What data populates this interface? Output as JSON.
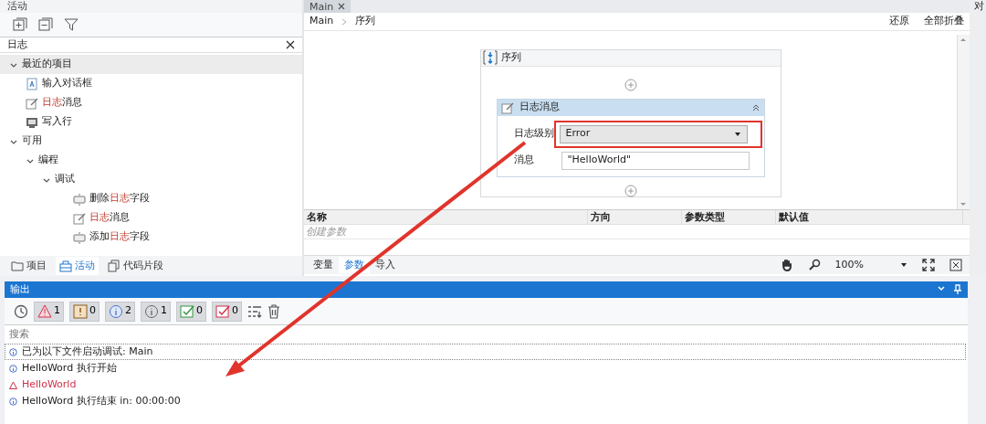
{
  "activities_panel": {
    "title": "活动",
    "search": {
      "value": "日志"
    },
    "tree": [
      {
        "label": "最近的项目",
        "expanded": true,
        "selected": true,
        "children": [
          {
            "kind": "dialog",
            "selected": false,
            "parts": [
              {
                "text": "输入对话框",
                "match": false
              }
            ]
          },
          {
            "kind": "log",
            "selected": false,
            "parts": [
              {
                "text": "日志",
                "match": true
              },
              {
                "text": "消息",
                "match": false
              }
            ]
          },
          {
            "kind": "writeline",
            "selected": false,
            "parts": [
              {
                "text": "写入行",
                "match": false
              }
            ]
          }
        ]
      },
      {
        "label": "可用",
        "expanded": true,
        "selected": false,
        "children": [
          {
            "label": "编程",
            "expanded": true,
            "selected": false,
            "children": [
              {
                "label": "调试",
                "expanded": true,
                "selected": false,
                "children": [
                  {
                    "kind": "field",
                    "selected": false,
                    "parts": [
                      {
                        "text": "删除",
                        "match": false
                      },
                      {
                        "text": "日志",
                        "match": true
                      },
                      {
                        "text": "字段",
                        "match": false
                      }
                    ]
                  },
                  {
                    "kind": "log",
                    "selected": false,
                    "parts": [
                      {
                        "text": "日志",
                        "match": true
                      },
                      {
                        "text": "消息",
                        "match": false
                      }
                    ]
                  },
                  {
                    "kind": "field",
                    "selected": false,
                    "parts": [
                      {
                        "text": "添加",
                        "match": false
                      },
                      {
                        "text": "日志",
                        "match": true
                      },
                      {
                        "text": "字段",
                        "match": false
                      }
                    ]
                  }
                ]
              }
            ]
          }
        ]
      }
    ],
    "bottom_tabs": [
      {
        "label": "项目",
        "kind": "folder",
        "selected": false
      },
      {
        "label": "活动",
        "kind": "activities",
        "selected": true
      },
      {
        "label": "代码片段",
        "kind": "snippets",
        "selected": false
      }
    ]
  },
  "editor": {
    "tabs": [
      {
        "label": "Main",
        "selected": true
      }
    ],
    "breadcrumb": [
      "Main",
      "序列"
    ],
    "actions": [
      "还原",
      "全部折叠"
    ],
    "sequence": {
      "title": "序列",
      "activity": {
        "title": "日志消息",
        "fields": [
          {
            "label": "日志级别",
            "kind": "dropdown",
            "value": "Error",
            "highlighted": true
          },
          {
            "label": "消息",
            "kind": "text",
            "value": "\"HelloWorld\"",
            "highlighted": false
          }
        ]
      }
    },
    "arguments": {
      "columns": [
        "名称",
        "方向",
        "参数类型",
        "默认值"
      ],
      "placeholder_row": "创建参数"
    },
    "bottom_tabs": [
      {
        "label": "变量",
        "selected": false
      },
      {
        "label": "参数",
        "selected": true
      },
      {
        "label": "导入",
        "selected": false
      }
    ],
    "zoom": "100%"
  },
  "edge_text": "对",
  "output": {
    "title": "输出",
    "filters": [
      {
        "kind": "error",
        "count": "1",
        "selected": true
      },
      {
        "kind": "warning",
        "count": "0",
        "selected": true
      },
      {
        "kind": "info",
        "count": "2",
        "selected": true
      },
      {
        "kind": "trace",
        "count": "1",
        "selected": true
      },
      {
        "kind": "verbose",
        "count": "0",
        "selected": true
      },
      {
        "kind": "failure",
        "count": "0",
        "selected": true
      }
    ],
    "search": {
      "placeholder": "搜索"
    },
    "entries": [
      {
        "kind": "info",
        "text": "已为以下文件启动调试: Main",
        "focused": true
      },
      {
        "kind": "info",
        "text": "HelloWord 执行开始",
        "focused": false
      },
      {
        "kind": "error",
        "text": "HelloWorld",
        "focused": false
      },
      {
        "kind": "info",
        "text": "HelloWord 执行结束 in: 00:00:00",
        "focused": false
      }
    ]
  }
}
